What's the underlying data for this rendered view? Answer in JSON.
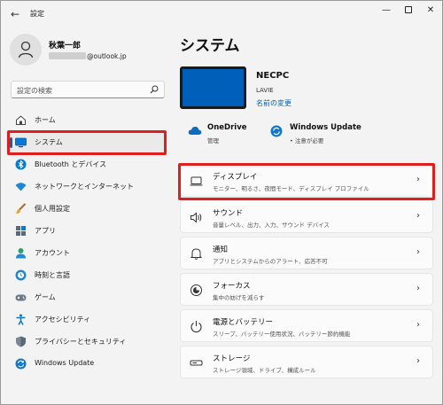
{
  "window": {
    "title": "設定",
    "back_glyph": "←",
    "min_glyph": "—",
    "close_glyph": "✕"
  },
  "user": {
    "name": "秋葉一郎",
    "email_suffix": "@outlook.jp"
  },
  "search": {
    "placeholder": "設定の検索"
  },
  "sidebar": {
    "items": [
      {
        "label": "ホーム",
        "icon": "home-icon"
      },
      {
        "label": "システム",
        "icon": "monitor-icon",
        "active": true
      },
      {
        "label": "Bluetooth とデバイス",
        "icon": "bluetooth-icon"
      },
      {
        "label": "ネットワークとインターネット",
        "icon": "wifi-icon"
      },
      {
        "label": "個人用設定",
        "icon": "brush-icon"
      },
      {
        "label": "アプリ",
        "icon": "apps-icon"
      },
      {
        "label": "アカウント",
        "icon": "account-icon"
      },
      {
        "label": "時刻と言語",
        "icon": "globe-clock-icon"
      },
      {
        "label": "ゲーム",
        "icon": "gamepad-icon"
      },
      {
        "label": "アクセシビリティ",
        "icon": "accessibility-icon"
      },
      {
        "label": "プライバシーとセキュリティ",
        "icon": "shield-icon"
      },
      {
        "label": "Windows Update",
        "icon": "sync-icon"
      }
    ]
  },
  "main": {
    "title": "システム",
    "device": {
      "name": "NECPC",
      "model": "LAVIE",
      "rename_link": "名前の変更"
    },
    "status": [
      {
        "title": "OneDrive",
        "sub": "管理",
        "icon": "cloud-icon"
      },
      {
        "title": "Windows Update",
        "sub": "• 注意が必要",
        "icon": "sync-icon"
      }
    ],
    "cards": [
      {
        "title": "ディスプレイ",
        "sub": "モニター、明るさ、夜間モード、ディスプレイ プロファイル",
        "icon": "display-icon"
      },
      {
        "title": "サウンド",
        "sub": "音量レベル、出力、入力、サウンド デバイス",
        "icon": "speaker-icon"
      },
      {
        "title": "通知",
        "sub": "アプリとシステムからのアラート、応答不可",
        "icon": "bell-icon"
      },
      {
        "title": "フォーカス",
        "sub": "集中の妨げを減らす",
        "icon": "focus-icon"
      },
      {
        "title": "電源とバッテリー",
        "sub": "スリープ、バッテリー使用状況、バッテリー節約機能",
        "icon": "power-icon"
      },
      {
        "title": "ストレージ",
        "sub": "ストレージ領域、ドライブ、構成ルール",
        "icon": "storage-icon"
      }
    ],
    "chevron": "›"
  },
  "colors": {
    "accent": "#0067c0",
    "highlight": "#e01e1e",
    "device_screen": "#005fb8"
  }
}
